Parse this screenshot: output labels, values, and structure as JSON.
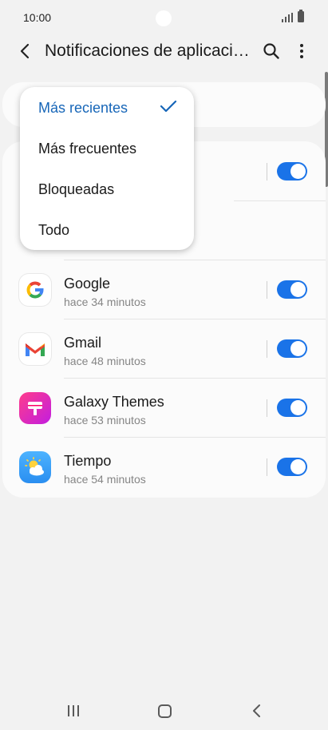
{
  "status_bar": {
    "time": "10:00"
  },
  "header": {
    "title": "Notificaciones de aplicaciones"
  },
  "dropdown": {
    "items": [
      {
        "label": "Más recientes",
        "selected": true
      },
      {
        "label": "Más frecuentes",
        "selected": false
      },
      {
        "label": "Bloqueadas",
        "selected": false
      },
      {
        "label": "Todo",
        "selected": false
      }
    ]
  },
  "apps": [
    {
      "name": "",
      "time": "",
      "enabled": true
    },
    {
      "name": "",
      "time": "",
      "enabled": true
    },
    {
      "name": "Google",
      "time": "hace 34 minutos",
      "enabled": true,
      "icon": "google-icon"
    },
    {
      "name": "Gmail",
      "time": "hace 48 minutos",
      "enabled": true,
      "icon": "gmail-icon"
    },
    {
      "name": "Galaxy Themes",
      "time": "hace 53 minutos",
      "enabled": true,
      "icon": "galaxy-themes-icon"
    },
    {
      "name": "Tiempo",
      "time": "hace 54 minutos",
      "enabled": true,
      "icon": "weather-icon"
    }
  ],
  "colors": {
    "accent": "#1a73e8",
    "selected_text": "#1766b8"
  }
}
